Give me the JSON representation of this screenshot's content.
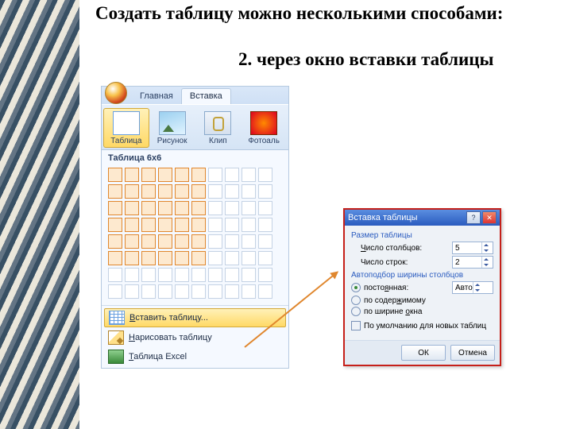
{
  "heading": "Создать таблицу можно несколькими способами:",
  "subheading": "2. через окно вставки таблицы",
  "ribbon": {
    "tabs": {
      "home": "Главная",
      "insert": "Вставка"
    },
    "buttons": {
      "table": "Таблица",
      "picture": "Рисунок",
      "clip": "Клип",
      "photo": "Фотоаль"
    }
  },
  "dropdown": {
    "title": "Таблица 6x6",
    "items": {
      "insert": "ставить таблицу...",
      "insert_u": "В",
      "draw": "арисовать таблицу",
      "draw_u": "Н",
      "excel": "аблица Excel",
      "excel_u": "Т"
    }
  },
  "dialog": {
    "title": "Вставка таблицы",
    "size_section": "Размер таблицы",
    "cols_label": "исло столбцов:",
    "cols_u": "Ч",
    "cols_value": "5",
    "rows_label": "Число строк:",
    "rows_value": "2",
    "autofit_section": "Автоподбор ширины столбцов",
    "opt_fixed": "посто",
    "opt_fixed2": "нная:",
    "opt_fixed_u": "я",
    "fixed_value": "Авто",
    "opt_content": "по содер",
    "opt_content2": "имому",
    "opt_content_u": "ж",
    "opt_window": "по ширине ",
    "opt_window2": "кна",
    "opt_window_u": "о",
    "remember": "По умолчанию для новых таблиц",
    "ok": "ОК",
    "cancel": "Отмена"
  },
  "chart_data": {
    "type": "table",
    "title": "Таблица 6x6",
    "grid": {
      "total_cols": 10,
      "total_rows": 8,
      "selected_cols": 6,
      "selected_rows": 6
    }
  }
}
